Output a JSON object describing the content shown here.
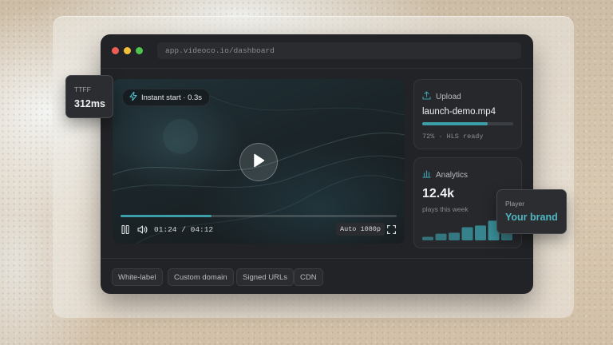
{
  "browser": {
    "url": "app.videoco.io/dashboard"
  },
  "player": {
    "badge_label": "Instant start · 0.3s",
    "current_time": "01:24",
    "duration": "04:12",
    "time_separator": "/",
    "progress_fraction": 0.33,
    "quality_label": "Auto 1080p"
  },
  "upload": {
    "title": "Upload",
    "filename": "launch-demo.mp4",
    "progress_percent": 72,
    "status": "72% · HLS ready"
  },
  "analytics": {
    "title": "Analytics",
    "value": "12.4k",
    "caption": "plays this week",
    "bar_levels": [
      0.15,
      0.28,
      0.32,
      0.55,
      0.62,
      0.82,
      0.4
    ]
  },
  "features": [
    "White-label",
    "Custom domain",
    "Signed URLs",
    "CDN"
  ],
  "ttff": {
    "label": "TTFF",
    "value": "312ms"
  },
  "player_badge": {
    "label": "Player",
    "value": "Your brand"
  },
  "colors": {
    "accent": "#3c9ea8",
    "brand_text": "#4fb8c2",
    "window_bg": "#222326",
    "traffic_red": "#ee5c56",
    "traffic_yellow": "#f2bf3b",
    "traffic_green": "#4fc44c"
  },
  "icons": {
    "badge": "lightning-icon",
    "play": "play-icon",
    "pause": "pause-icon",
    "volume": "volume-icon",
    "fullscreen": "fullscreen-icon",
    "upload": "upload-icon",
    "analytics": "bar-chart-icon"
  }
}
